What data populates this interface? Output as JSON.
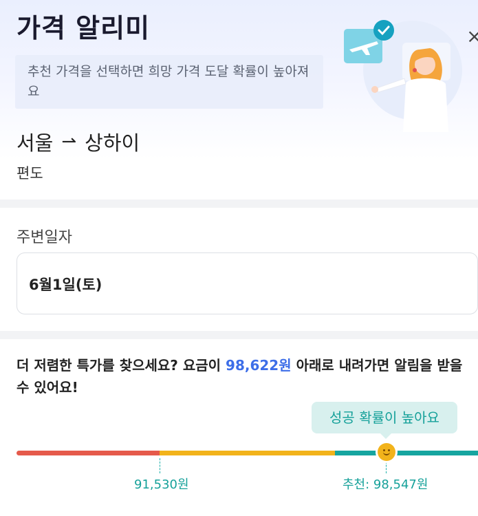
{
  "header": {
    "title": "가격 알리미",
    "close_glyph": "×",
    "notice": "추천 가격을 선택하면 희망 가격 도달 확률이 높아져요",
    "illustration": "traveler-with-plane-ticket"
  },
  "route": {
    "origin": "서울",
    "arrow_glyph": "⇀",
    "destination": "상하이",
    "trip_type": "편도"
  },
  "date_section": {
    "label": "주변일자",
    "value": "6월1일(토)"
  },
  "price_alert": {
    "desc_prefix": "더 저렴한 특가를 찾으세요? 요금이 ",
    "desc_price": "98,622원",
    "desc_suffix": " 아래로 내려가면 알림을 받을 수 있어요!",
    "tooltip": "성공 확률이 높아요",
    "low_price_label": "91,530원",
    "recommended_label": "추천: 98,547원",
    "colors": {
      "low": "#e55a4b",
      "mid": "#f2b31b",
      "high": "#16a5a0",
      "accent": "#3d6ee8"
    }
  }
}
